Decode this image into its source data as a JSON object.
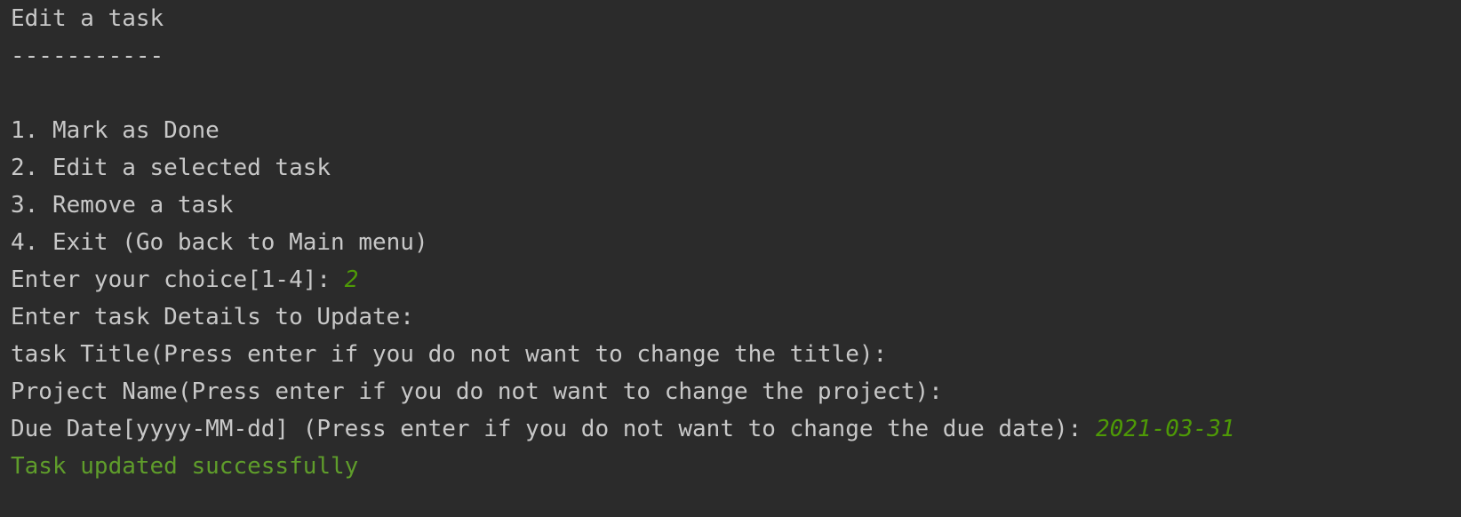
{
  "console": {
    "header": {
      "title": "Edit a task",
      "underline": "-----------"
    },
    "menu": [
      "1. Mark as Done",
      "2. Edit a selected task",
      "3. Remove a task",
      "4. Exit (Go back to Main menu)"
    ],
    "choice_prompt": "Enter your choice[1-4]: ",
    "choice_input": "2",
    "details_prompt": "Enter task Details to Update:",
    "title_prompt": "task Title(Press enter if you do not want to change the title):",
    "project_prompt": "Project Name(Press enter if you do not want to change the project):",
    "due_prompt": "Due Date[yyyy-MM-dd] (Press enter if you do not want to change the due date): ",
    "due_input": "2021-03-31",
    "success_message": "Task updated successfully"
  },
  "colors": {
    "background": "#2b2b2b",
    "text": "#c8c8c8",
    "user_input": "#4e9a06",
    "success": "#5f9d2b"
  }
}
